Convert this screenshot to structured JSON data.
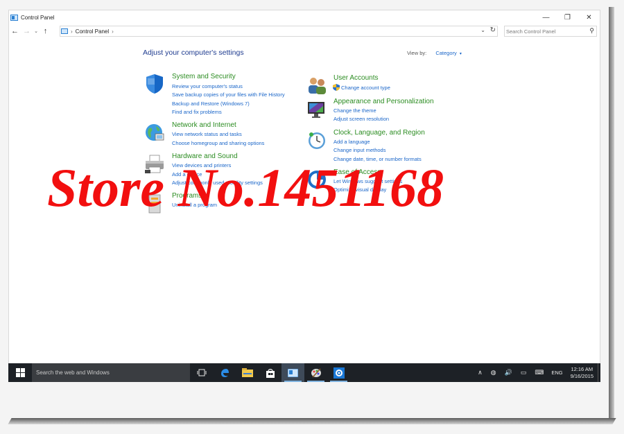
{
  "window": {
    "title": "Control Panel",
    "minimize": "—",
    "restore": "❐",
    "close": "✕"
  },
  "address": {
    "back": "←",
    "forward": "→",
    "recent": "⌄",
    "up": "↑",
    "separator_1": "›",
    "crumb": "Control Panel",
    "separator_2": "›",
    "dropdown": "⌄",
    "refresh": "↻",
    "search_placeholder": "Search Control Panel",
    "search_icon": "⚲"
  },
  "content": {
    "heading": "Adjust your computer's settings",
    "view_by_label": "View by:",
    "view_by_value": "Category",
    "view_by_caret": "▾"
  },
  "categories_left": [
    {
      "title": "System and Security",
      "icon": "shield-icon",
      "links": [
        "Review your computer's status",
        "Save backup copies of your files with File History",
        "Backup and Restore (Windows 7)",
        "Find and fix problems"
      ]
    },
    {
      "title": "Network and Internet",
      "icon": "globe-icon",
      "links": [
        "View network status and tasks",
        "Choose homegroup and sharing options"
      ]
    },
    {
      "title": "Hardware and Sound",
      "icon": "printer-icon",
      "links": [
        "View devices and printers",
        "Add a device",
        "Adjust commonly used mobility settings"
      ]
    },
    {
      "title": "Programs",
      "icon": "programs-icon",
      "links": [
        "Uninstall a program"
      ]
    }
  ],
  "categories_right": [
    {
      "title": "User Accounts",
      "icon": "users-icon",
      "links": [
        "Change account type"
      ]
    },
    {
      "title": "Appearance and Personalization",
      "icon": "monitor-icon",
      "links": [
        "Change the theme",
        "Adjust screen resolution"
      ]
    },
    {
      "title": "Clock, Language, and Region",
      "icon": "clock-icon",
      "links": [
        "Add a language",
        "Change input methods",
        "Change date, time, or number formats"
      ]
    },
    {
      "title": "Ease of Access",
      "icon": "ease-of-access-icon",
      "links": [
        "Let Windows suggest settings",
        "Optimize visual display"
      ]
    }
  ],
  "watermark": "Store No.1451168",
  "taskbar": {
    "search_placeholder": "Search the web and Windows",
    "tray_up": "∧",
    "tray_network": "◍",
    "tray_volume": "🔊",
    "tray_notify": "▭",
    "tray_keyboard": "⌨",
    "language": "ENG",
    "time": "12:16 AM",
    "date": "9/16/2015"
  },
  "colors": {
    "link": "#1a66c9",
    "category_title": "#2b8c21",
    "heading": "#1e3b8f",
    "watermark": "#f20f0f",
    "taskbar": "#1d2126"
  }
}
